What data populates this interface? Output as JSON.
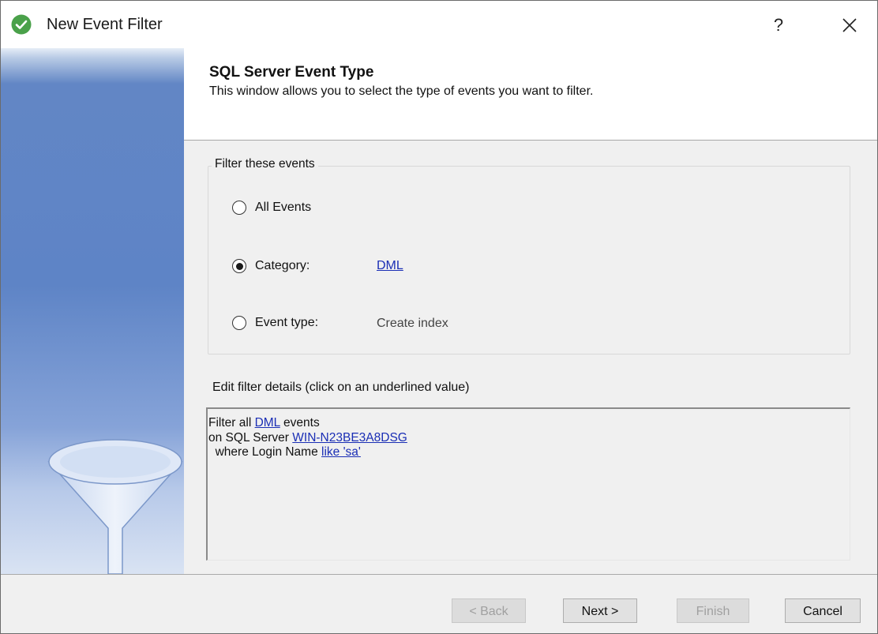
{
  "window": {
    "title": "New Event Filter",
    "help_label": "?",
    "icon": "check-circle-icon",
    "close_icon": "close-icon"
  },
  "header": {
    "title": "SQL Server Event Type",
    "description": "This window allows you to select the type of events you want to filter."
  },
  "filter_group": {
    "legend": "Filter these events",
    "options": [
      {
        "label": "All Events",
        "selected": false
      },
      {
        "label": "Category:",
        "selected": true,
        "value": "DML"
      },
      {
        "label": "Event type:",
        "selected": false,
        "value": "Create index"
      }
    ]
  },
  "details": {
    "label": "Edit filter details (click on an underlined value)",
    "line1_prefix": "Filter all ",
    "line1_link": "DML",
    "line1_suffix": " events",
    "line2_prefix": "on SQL Server ",
    "line2_link": "WIN-N23BE3A8DSG",
    "line3_prefix": "  where Login Name ",
    "line3_link": "like 'sa'"
  },
  "buttons": {
    "back": "< Back",
    "next": "Next >",
    "finish": "Finish",
    "cancel": "Cancel"
  },
  "colors": {
    "link": "#1a2eb5",
    "banner": "#5e84c6",
    "title_icon": "#4aa14a"
  }
}
